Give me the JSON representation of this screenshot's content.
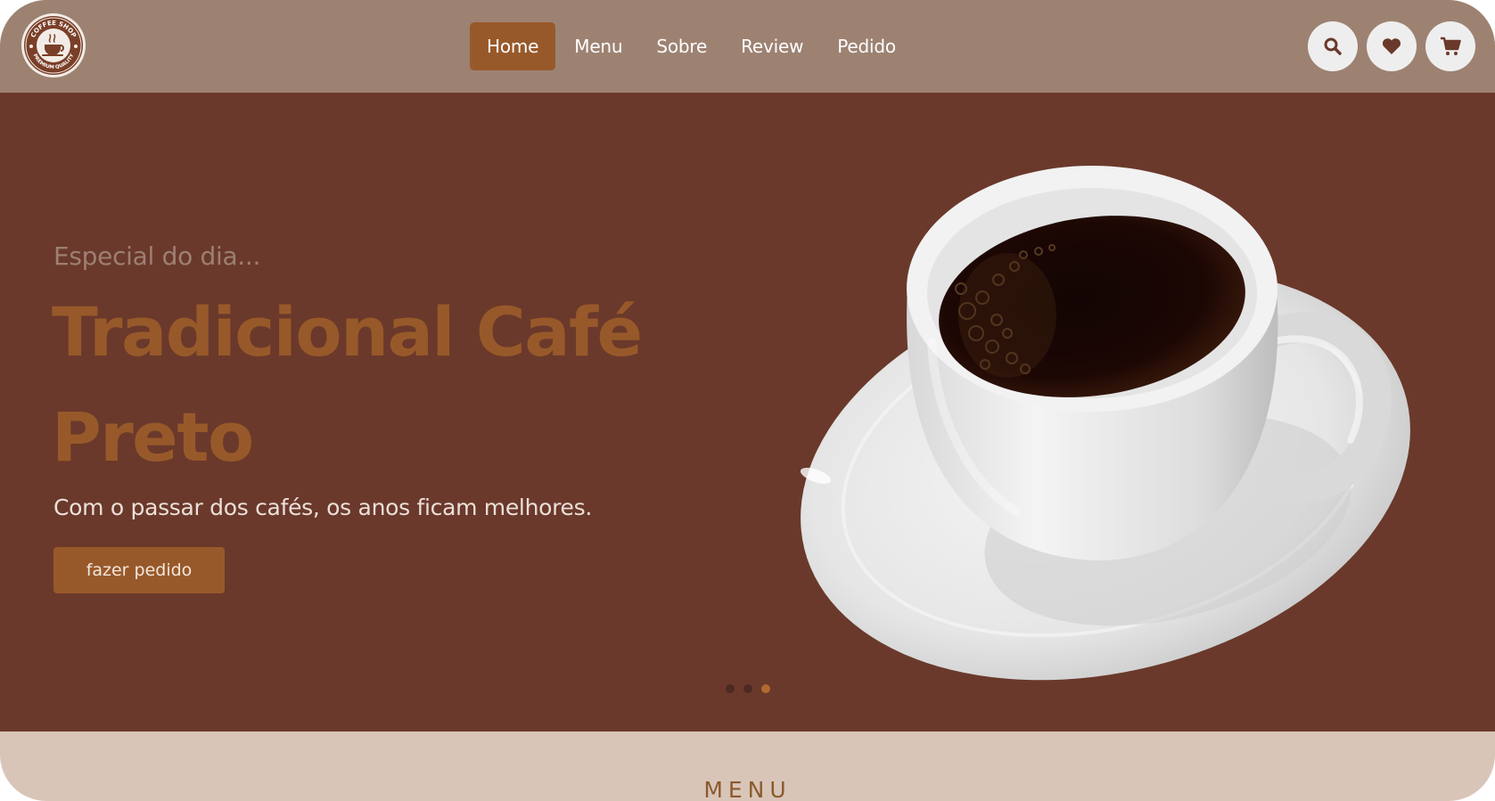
{
  "logo": {
    "top_text": "COFFEE SHOP",
    "bottom_text": "PREMIUM QUALITY",
    "icon": "coffee-cup-icon"
  },
  "nav": {
    "items": [
      {
        "label": "Home",
        "active": true
      },
      {
        "label": "Menu",
        "active": false
      },
      {
        "label": "Sobre",
        "active": false
      },
      {
        "label": "Review",
        "active": false
      },
      {
        "label": "Pedido",
        "active": false
      }
    ]
  },
  "header_icons": [
    "search-icon",
    "heart-icon",
    "cart-icon"
  ],
  "hero": {
    "eyebrow": "Especial do dia...",
    "title_line1": "Tradicional Café",
    "title_line2": "Preto",
    "subtitle": "Com o passar dos cafés, os anos ficam melhores.",
    "cta_label": "fazer pedido",
    "slides_total": 3,
    "active_slide": 3
  },
  "section": {
    "heading": "MENU"
  },
  "colors": {
    "header_bg": "#9d8272",
    "hero_bg": "#6a392b",
    "accent": "#98592a",
    "strip_bg": "#d9c5b8"
  }
}
